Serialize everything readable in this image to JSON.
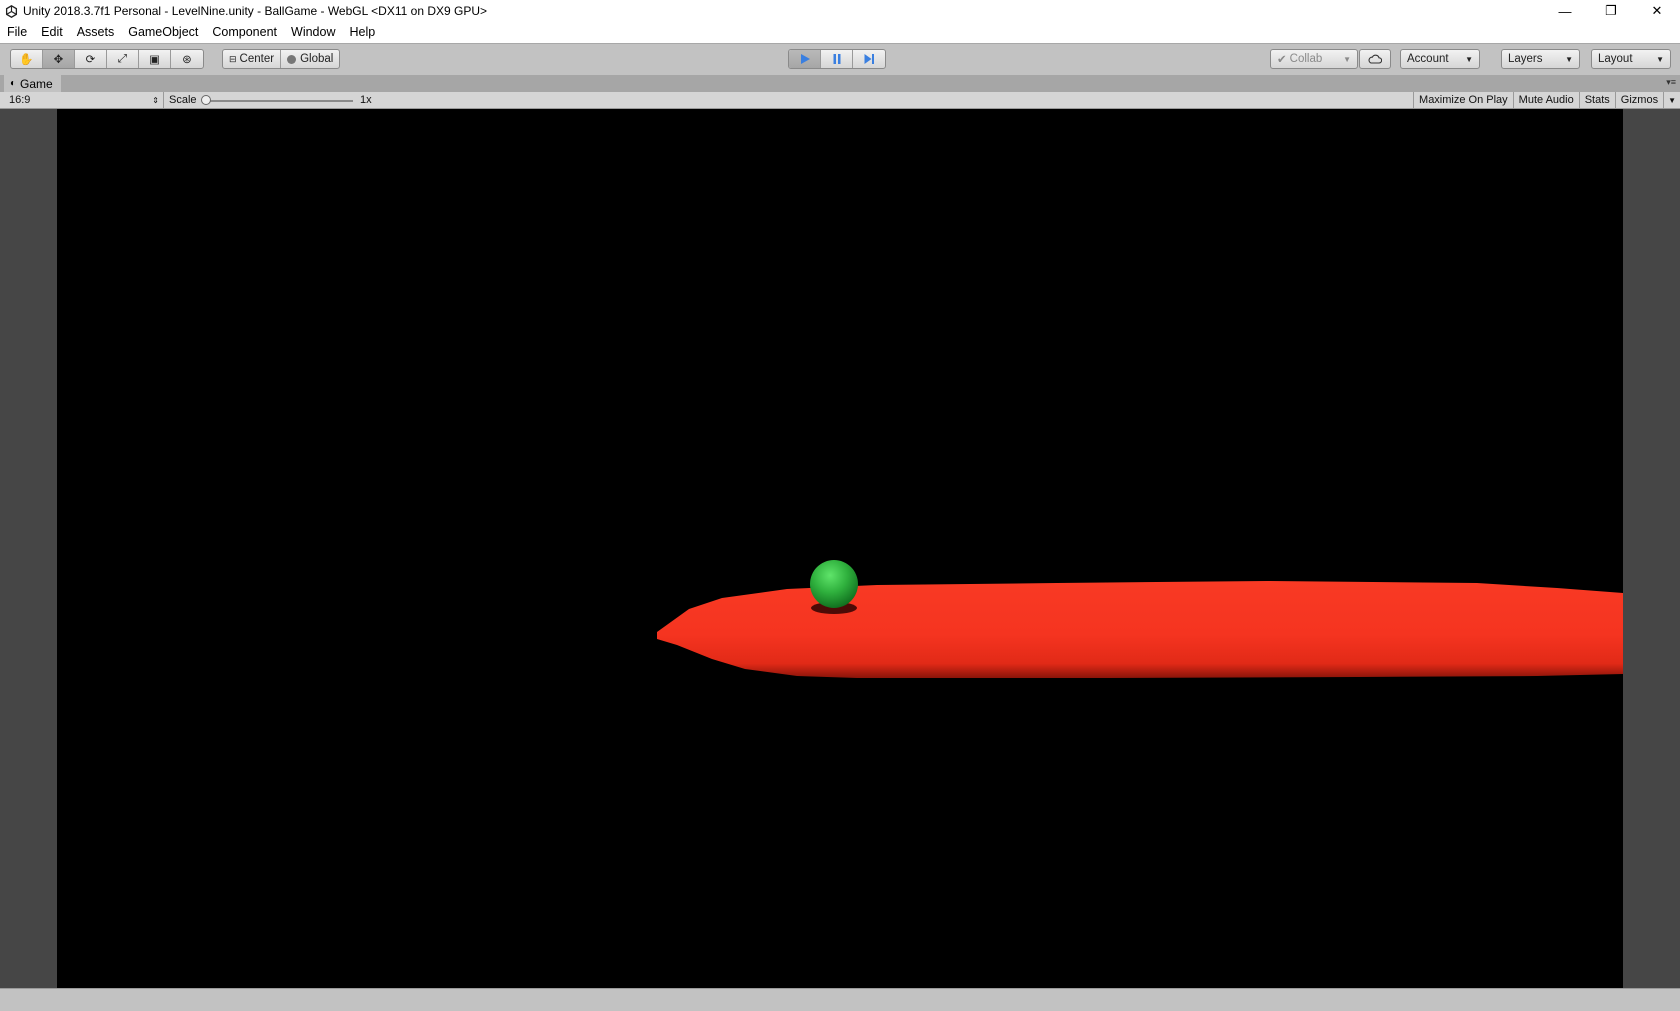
{
  "window": {
    "title": "Unity 2018.3.7f1 Personal - LevelNine.unity - BallGame - WebGL <DX11 on DX9 GPU>",
    "icon": "unity-logo-icon",
    "controls": {
      "minimize": "—",
      "maximize": "❐",
      "close": "✕"
    }
  },
  "menu": {
    "items": [
      "File",
      "Edit",
      "Assets",
      "GameObject",
      "Component",
      "Window",
      "Help"
    ]
  },
  "toolbar": {
    "tools": [
      {
        "name": "hand-tool",
        "glyph": "✋",
        "active": false
      },
      {
        "name": "move-tool",
        "glyph": "✥",
        "active": true
      },
      {
        "name": "rotate-tool",
        "glyph": "⟳",
        "active": false
      },
      {
        "name": "scale-tool",
        "glyph": "⤢",
        "active": false
      },
      {
        "name": "rect-tool",
        "glyph": "▣",
        "active": false
      },
      {
        "name": "transform-tool",
        "glyph": "⊛",
        "active": false
      }
    ],
    "pivot_mode": "Center",
    "pivot_rotation": "Global",
    "play_active": true,
    "pause_active": false,
    "collab": "Collab",
    "account": "Account",
    "layers": "Layers",
    "layout": "Layout",
    "accent": "#3a7fe0"
  },
  "game_tab": {
    "label": "Game",
    "aspect": "16:9",
    "scale_label": "Scale",
    "scale_value": "1x",
    "buttons": [
      {
        "label": "Maximize On Play",
        "on": false
      },
      {
        "label": "Mute Audio",
        "on": false
      },
      {
        "label": "Stats",
        "on": false
      },
      {
        "label": "Gizmos",
        "on": false
      }
    ]
  },
  "scene": {
    "background": "#000000",
    "platform_color": "#f93420",
    "ball_color": "#2dac3c"
  }
}
